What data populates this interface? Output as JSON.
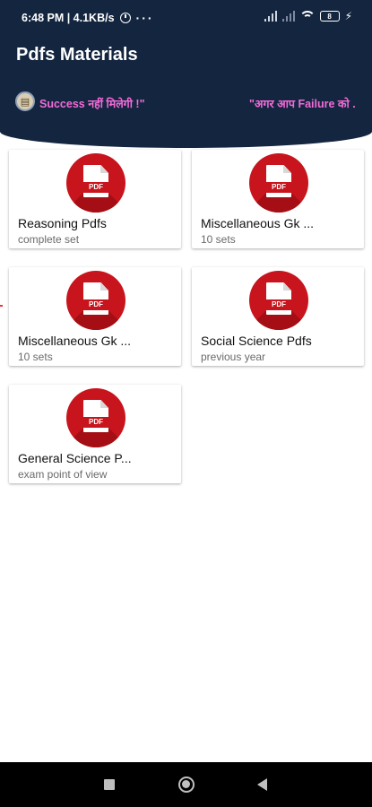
{
  "status_bar": {
    "time_speed": "6:48 PM | 4.1KB/s",
    "more": "···",
    "battery": "8"
  },
  "header": {
    "title": "Pdfs Materials"
  },
  "ticker": {
    "left_text": "Success नहीं मिलेगी !\"",
    "right_text": "\"अगर आप Failure को ."
  },
  "cards": [
    {
      "title": "Reasoning Pdfs",
      "subtitle": "complete set",
      "badge": "PDF"
    },
    {
      "title": "Miscellaneous Gk ...",
      "subtitle": "10 sets",
      "badge": "PDF"
    },
    {
      "title": "Miscellaneous Gk ...",
      "subtitle": "10 sets",
      "badge": "PDF"
    },
    {
      "title": "Social Science Pdfs",
      "subtitle": "previous year",
      "badge": "PDF"
    },
    {
      "title": "General Science P...",
      "subtitle": "exam point of view",
      "badge": "PDF"
    }
  ],
  "colors": {
    "header_bg": "#14253f",
    "ticker_text": "#f36bd8",
    "pdf_red": "#c8141c"
  }
}
